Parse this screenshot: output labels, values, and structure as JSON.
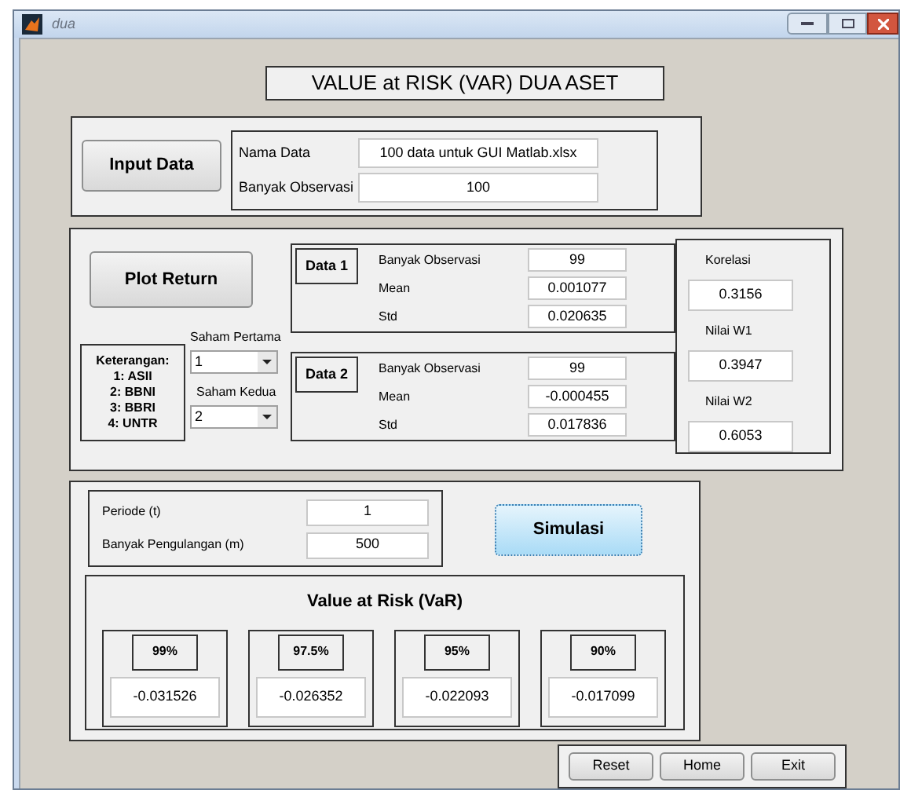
{
  "window": {
    "title": "dua"
  },
  "header": "VALUE at RISK (VAR) DUA ASET",
  "input_panel": {
    "button": "Input Data",
    "fields": [
      {
        "label": "Nama Data",
        "value": "100 data untuk GUI Matlab.xlsx"
      },
      {
        "label": "Banyak Observasi",
        "value": "100"
      }
    ]
  },
  "return_panel": {
    "button": "Plot Return",
    "legend": {
      "title": "Keterangan:",
      "items": [
        "1: ASII",
        "2: BBNI",
        "3: BBRI",
        "4: UNTR"
      ]
    },
    "selectors": [
      {
        "label": "Saham Pertama",
        "value": "1"
      },
      {
        "label": "Saham Kedua",
        "value": "2"
      }
    ],
    "datasets": [
      {
        "title": "Data 1",
        "fields": [
          {
            "label": "Banyak Observasi",
            "value": "99"
          },
          {
            "label": "Mean",
            "value": "0.001077"
          },
          {
            "label": "Std",
            "value": "0.020635"
          }
        ]
      },
      {
        "title": "Data 2",
        "fields": [
          {
            "label": "Banyak Observasi",
            "value": "99"
          },
          {
            "label": "Mean",
            "value": "-0.000455"
          },
          {
            "label": "Std",
            "value": "0.017836"
          }
        ]
      }
    ],
    "stats": [
      {
        "label": "Korelasi",
        "value": "0.3156"
      },
      {
        "label": "Nilai W1",
        "value": "0.3947"
      },
      {
        "label": "Nilai W2",
        "value": "0.6053"
      }
    ]
  },
  "simulation_panel": {
    "fields": [
      {
        "label": "Periode (t)",
        "value": "1"
      },
      {
        "label": "Banyak Pengulangan (m)",
        "value": "500"
      }
    ],
    "button": {
      "label": "Simulasi",
      "focused": true
    },
    "var": {
      "title": "Value at Risk (VaR)",
      "levels": [
        {
          "label": "99%",
          "value": "-0.031526"
        },
        {
          "label": "97.5%",
          "value": "-0.026352"
        },
        {
          "label": "95%",
          "value": "-0.022093"
        },
        {
          "label": "90%",
          "value": "-0.017099"
        }
      ]
    }
  },
  "buttons": [
    "Reset",
    "Home",
    "Exit"
  ]
}
